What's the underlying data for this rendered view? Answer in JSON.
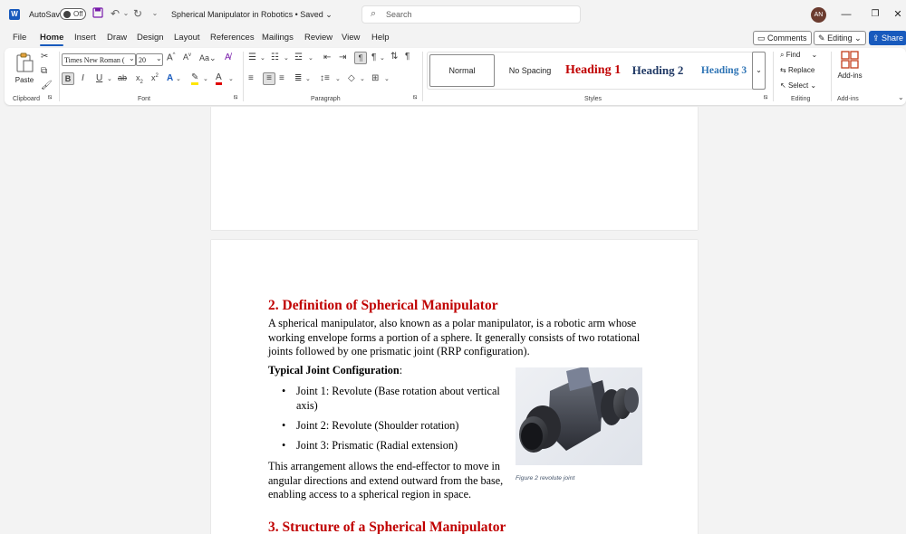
{
  "titlebar": {
    "autosave_label": "AutoSave",
    "autosave_state": "Off",
    "doc_title": "Spherical Manipulator in Robotics • Saved",
    "search_placeholder": "Search",
    "avatar_initials": "AN"
  },
  "menu": {
    "tabs": [
      "File",
      "Home",
      "Insert",
      "Draw",
      "Design",
      "Layout",
      "References",
      "Mailings",
      "Review",
      "View",
      "Help"
    ],
    "active": "Home",
    "comments_label": "Comments",
    "editing_label": "Editing",
    "share_label": "Share"
  },
  "ribbon": {
    "clipboard": {
      "paste_label": "Paste",
      "group_label": "Clipboard"
    },
    "font": {
      "font_name": "Times New Roman (",
      "font_size": "20",
      "group_label": "Font"
    },
    "paragraph": {
      "group_label": "Paragraph"
    },
    "styles": {
      "items": [
        "Normal",
        "No Spacing",
        "Heading 1",
        "Heading 2",
        "Heading 3"
      ],
      "group_label": "Styles"
    },
    "editing": {
      "find_label": "Find",
      "replace_label": "Replace",
      "select_label": "Select",
      "group_label": "Editing"
    },
    "addins": {
      "label": "Add-ins",
      "group_label": "Add-ins"
    }
  },
  "document": {
    "section2_heading": "2. Definition of Spherical Manipulator",
    "section2_para_lines": [
      "A spherical manipulator, also known as a polar manipulator, is a robotic arm whose",
      "working envelope forms a portion of a sphere. It generally consists of two rotational",
      "joints followed by one prismatic joint (RRP configuration)."
    ],
    "typical_label": "Typical Joint Configuration",
    "typical_colon": ":",
    "bullets": [
      {
        "line1": "Joint 1: Revolute (Base rotation about vertical",
        "line2": "axis)"
      },
      {
        "line1": "Joint 2: Revolute (Shoulder rotation)",
        "line2": ""
      },
      {
        "line1": "Joint 3: Prismatic (Radial extension)",
        "line2": ""
      }
    ],
    "arrangement_lines": [
      "This arrangement allows the end-effector to move in",
      "angular directions and extend outward from the base,",
      "enabling access to a spherical region in space."
    ],
    "figure_caption": "Figure 2 revolute joint",
    "section3_heading": "3. Structure of a Spherical Manipulator"
  },
  "colors": {
    "accent": "#185abd",
    "heading_red": "#c00000",
    "heading2_blue": "#1f3864",
    "heading3_blue": "#2e74b5"
  }
}
